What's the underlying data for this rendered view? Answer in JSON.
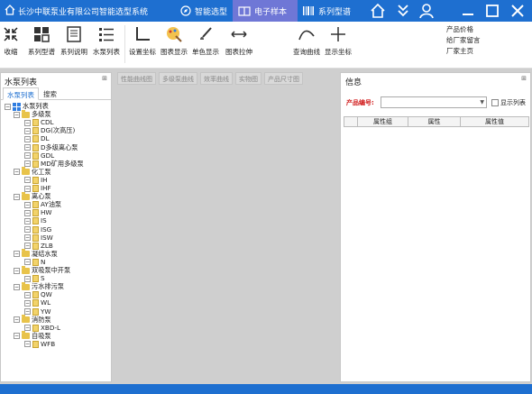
{
  "window": {
    "title": "长沙中联泵业有限公司智能选型系统",
    "tabs": [
      "智能选型",
      "电子样本",
      "系列型谱"
    ]
  },
  "ribbon": {
    "buttons": [
      "收缩",
      "系列型谱",
      "系列说明",
      "水泵列表",
      "设置坐标",
      "图表显示",
      "单色显示",
      "图表拉伸",
      "查询曲线",
      "显示坐标"
    ],
    "right_links": [
      "产品价格",
      "给厂家留言",
      "厂家主页"
    ]
  },
  "left_panel": {
    "title": "水泵列表",
    "pin": "⊞",
    "tabs": [
      "水泵列表",
      "搜索"
    ],
    "tree": {
      "root": "水泵列表",
      "categories": [
        {
          "name": "多级泵",
          "children": [
            "CDL",
            "DG(次高压)",
            "DL",
            "D多级离心泵",
            "GDL",
            "MD矿用多级泵"
          ]
        },
        {
          "name": "化工泵",
          "children": [
            "IH",
            "IHF"
          ]
        },
        {
          "name": "离心泵",
          "children": [
            "AY油泵",
            "HW",
            "IS",
            "ISG",
            "ISW",
            "ZLB"
          ]
        },
        {
          "name": "凝结水泵",
          "children": [
            "N"
          ]
        },
        {
          "name": "双吸泵中开泵",
          "children": [
            "S"
          ]
        },
        {
          "name": "污水排污泵",
          "children": [
            "QW",
            "WL",
            "YW"
          ]
        },
        {
          "name": "消防泵",
          "children": [
            "XBD-L"
          ]
        },
        {
          "name": "自吸泵",
          "children": [
            "WFB"
          ]
        }
      ]
    }
  },
  "doc_tabs": [
    "性能曲线图",
    "多级泵曲线",
    "效率曲线",
    "实物图",
    "产品尺寸图"
  ],
  "right_panel": {
    "title": "信息",
    "pin": "⊞",
    "product_label": "产品编号:",
    "product_value": "",
    "show_list_label": "显示列表",
    "grid_columns": [
      "属性组",
      "属性",
      "属性值"
    ]
  },
  "colors": {
    "titlebar": "#1e6fd0",
    "active_tab": "#6f77d6",
    "accent_red": "#d01818"
  }
}
